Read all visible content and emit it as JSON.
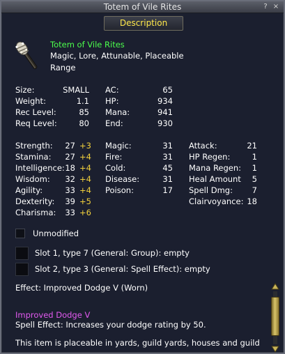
{
  "window": {
    "title": "Totem of Vile Rites",
    "help_glyph": "?",
    "close_glyph": "×"
  },
  "description_button": "Description",
  "item": {
    "name": "Totem of Vile Rites",
    "flags": "Magic, Lore, Attunable, Placeable",
    "slot": "Range",
    "icon": "totem-club-icon"
  },
  "basic": {
    "size": {
      "label": "Size:",
      "value": "SMALL"
    },
    "weight": {
      "label": "Weight:",
      "value": "1.1"
    },
    "rec_level": {
      "label": "Rec Level:",
      "value": "85"
    },
    "req_level": {
      "label": "Req Level:",
      "value": "80"
    },
    "ac": {
      "label": "AC:",
      "value": "65"
    },
    "hp": {
      "label": "HP:",
      "value": "934"
    },
    "mana": {
      "label": "Mana:",
      "value": "941"
    },
    "end": {
      "label": "End:",
      "value": "930"
    }
  },
  "attributes": [
    {
      "label": "Strength:",
      "value": "27",
      "bonus": "+3"
    },
    {
      "label": "Stamina:",
      "value": "27",
      "bonus": "+4"
    },
    {
      "label": "Intelligence:",
      "value": "18",
      "bonus": "+4"
    },
    {
      "label": "Wisdom:",
      "value": "32",
      "bonus": "+4"
    },
    {
      "label": "Agility:",
      "value": "33",
      "bonus": "+4"
    },
    {
      "label": "Dexterity:",
      "value": "39",
      "bonus": "+5"
    },
    {
      "label": "Charisma:",
      "value": "33",
      "bonus": "+6"
    }
  ],
  "resists": [
    {
      "label": "Magic:",
      "value": "31"
    },
    {
      "label": "Fire:",
      "value": "31"
    },
    {
      "label": "Cold:",
      "value": "45"
    },
    {
      "label": "Disease:",
      "value": "31"
    },
    {
      "label": "Poison:",
      "value": "17"
    }
  ],
  "mods": [
    {
      "label": "Attack:",
      "value": "21"
    },
    {
      "label": "HP Regen:",
      "value": "1"
    },
    {
      "label": "Mana Regen:",
      "value": "1"
    },
    {
      "label": "Heal Amount",
      "value": "5"
    },
    {
      "label": "Spell Dmg:",
      "value": "7"
    },
    {
      "label": "Clairvoyance:",
      "value": "18"
    }
  ],
  "unmodified_label": "Unmodified",
  "slots": [
    "Slot 1, type 7 (General: Group): empty",
    "Slot 2, type 3 (General: Spell Effect): empty"
  ],
  "effect": "Effect: Improved Dodge V (Worn)",
  "spell": {
    "name": "Improved Dodge V",
    "description": "Spell Effect: Increases your dodge rating by 50."
  },
  "placeable_text": "This item is placeable in yards, guild yards, houses and guild",
  "colors": {
    "item_name": "#4cff4c",
    "bonus": "#f0cf3c",
    "spell_name": "#e35af0",
    "button_text": "#ffe84a"
  }
}
